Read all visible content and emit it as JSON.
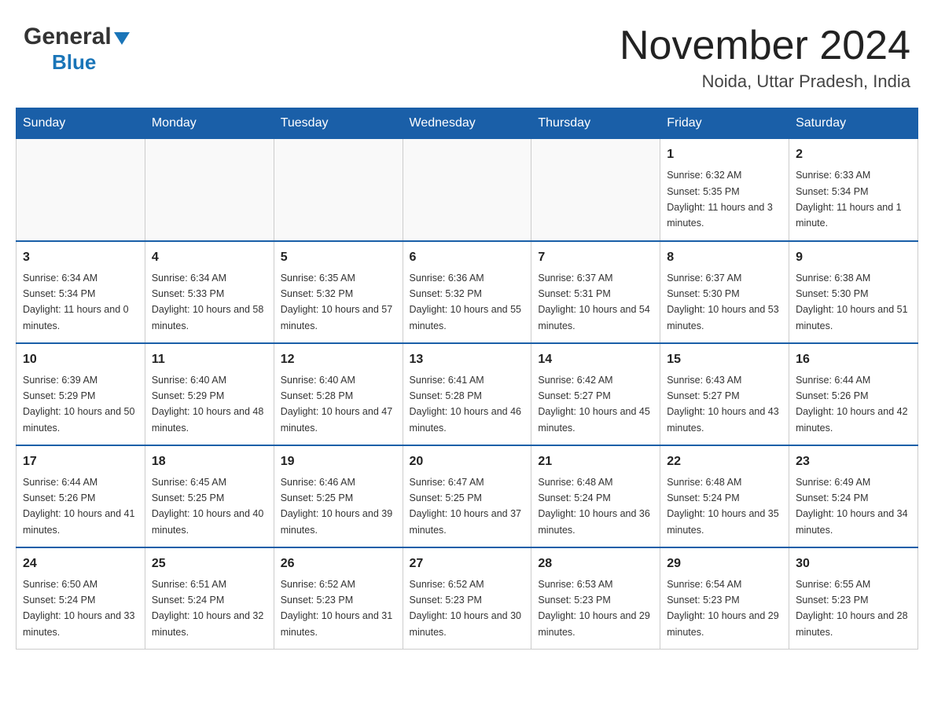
{
  "header": {
    "logo_general": "General",
    "logo_blue": "Blue",
    "month_title": "November 2024",
    "location": "Noida, Uttar Pradesh, India"
  },
  "days_of_week": [
    "Sunday",
    "Monday",
    "Tuesday",
    "Wednesday",
    "Thursday",
    "Friday",
    "Saturday"
  ],
  "weeks": [
    [
      {
        "day": "",
        "info": ""
      },
      {
        "day": "",
        "info": ""
      },
      {
        "day": "",
        "info": ""
      },
      {
        "day": "",
        "info": ""
      },
      {
        "day": "",
        "info": ""
      },
      {
        "day": "1",
        "info": "Sunrise: 6:32 AM\nSunset: 5:35 PM\nDaylight: 11 hours and 3 minutes."
      },
      {
        "day": "2",
        "info": "Sunrise: 6:33 AM\nSunset: 5:34 PM\nDaylight: 11 hours and 1 minute."
      }
    ],
    [
      {
        "day": "3",
        "info": "Sunrise: 6:34 AM\nSunset: 5:34 PM\nDaylight: 11 hours and 0 minutes."
      },
      {
        "day": "4",
        "info": "Sunrise: 6:34 AM\nSunset: 5:33 PM\nDaylight: 10 hours and 58 minutes."
      },
      {
        "day": "5",
        "info": "Sunrise: 6:35 AM\nSunset: 5:32 PM\nDaylight: 10 hours and 57 minutes."
      },
      {
        "day": "6",
        "info": "Sunrise: 6:36 AM\nSunset: 5:32 PM\nDaylight: 10 hours and 55 minutes."
      },
      {
        "day": "7",
        "info": "Sunrise: 6:37 AM\nSunset: 5:31 PM\nDaylight: 10 hours and 54 minutes."
      },
      {
        "day": "8",
        "info": "Sunrise: 6:37 AM\nSunset: 5:30 PM\nDaylight: 10 hours and 53 minutes."
      },
      {
        "day": "9",
        "info": "Sunrise: 6:38 AM\nSunset: 5:30 PM\nDaylight: 10 hours and 51 minutes."
      }
    ],
    [
      {
        "day": "10",
        "info": "Sunrise: 6:39 AM\nSunset: 5:29 PM\nDaylight: 10 hours and 50 minutes."
      },
      {
        "day": "11",
        "info": "Sunrise: 6:40 AM\nSunset: 5:29 PM\nDaylight: 10 hours and 48 minutes."
      },
      {
        "day": "12",
        "info": "Sunrise: 6:40 AM\nSunset: 5:28 PM\nDaylight: 10 hours and 47 minutes."
      },
      {
        "day": "13",
        "info": "Sunrise: 6:41 AM\nSunset: 5:28 PM\nDaylight: 10 hours and 46 minutes."
      },
      {
        "day": "14",
        "info": "Sunrise: 6:42 AM\nSunset: 5:27 PM\nDaylight: 10 hours and 45 minutes."
      },
      {
        "day": "15",
        "info": "Sunrise: 6:43 AM\nSunset: 5:27 PM\nDaylight: 10 hours and 43 minutes."
      },
      {
        "day": "16",
        "info": "Sunrise: 6:44 AM\nSunset: 5:26 PM\nDaylight: 10 hours and 42 minutes."
      }
    ],
    [
      {
        "day": "17",
        "info": "Sunrise: 6:44 AM\nSunset: 5:26 PM\nDaylight: 10 hours and 41 minutes."
      },
      {
        "day": "18",
        "info": "Sunrise: 6:45 AM\nSunset: 5:25 PM\nDaylight: 10 hours and 40 minutes."
      },
      {
        "day": "19",
        "info": "Sunrise: 6:46 AM\nSunset: 5:25 PM\nDaylight: 10 hours and 39 minutes."
      },
      {
        "day": "20",
        "info": "Sunrise: 6:47 AM\nSunset: 5:25 PM\nDaylight: 10 hours and 37 minutes."
      },
      {
        "day": "21",
        "info": "Sunrise: 6:48 AM\nSunset: 5:24 PM\nDaylight: 10 hours and 36 minutes."
      },
      {
        "day": "22",
        "info": "Sunrise: 6:48 AM\nSunset: 5:24 PM\nDaylight: 10 hours and 35 minutes."
      },
      {
        "day": "23",
        "info": "Sunrise: 6:49 AM\nSunset: 5:24 PM\nDaylight: 10 hours and 34 minutes."
      }
    ],
    [
      {
        "day": "24",
        "info": "Sunrise: 6:50 AM\nSunset: 5:24 PM\nDaylight: 10 hours and 33 minutes."
      },
      {
        "day": "25",
        "info": "Sunrise: 6:51 AM\nSunset: 5:24 PM\nDaylight: 10 hours and 32 minutes."
      },
      {
        "day": "26",
        "info": "Sunrise: 6:52 AM\nSunset: 5:23 PM\nDaylight: 10 hours and 31 minutes."
      },
      {
        "day": "27",
        "info": "Sunrise: 6:52 AM\nSunset: 5:23 PM\nDaylight: 10 hours and 30 minutes."
      },
      {
        "day": "28",
        "info": "Sunrise: 6:53 AM\nSunset: 5:23 PM\nDaylight: 10 hours and 29 minutes."
      },
      {
        "day": "29",
        "info": "Sunrise: 6:54 AM\nSunset: 5:23 PM\nDaylight: 10 hours and 29 minutes."
      },
      {
        "day": "30",
        "info": "Sunrise: 6:55 AM\nSunset: 5:23 PM\nDaylight: 10 hours and 28 minutes."
      }
    ]
  ]
}
